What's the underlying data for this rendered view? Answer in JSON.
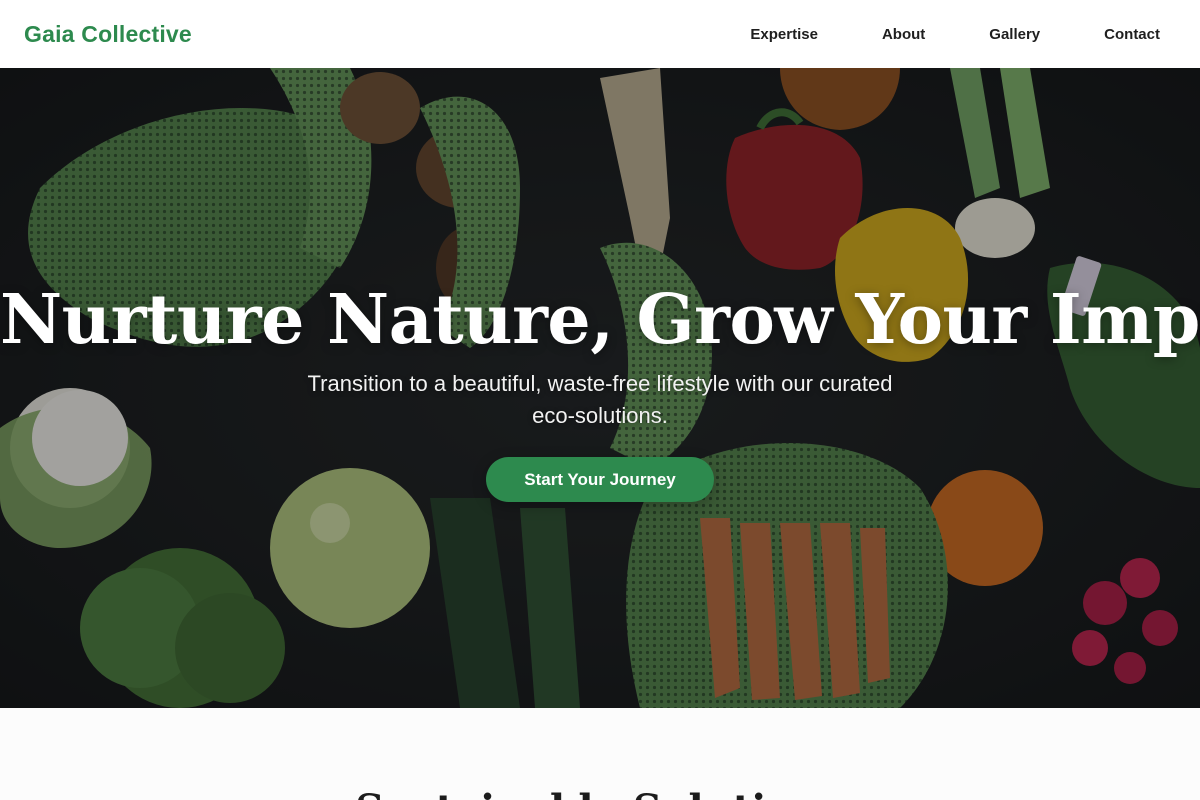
{
  "brand": {
    "name": "Gaia Collective",
    "color": "#2d8a4e"
  },
  "nav": {
    "links": [
      {
        "label": "Expertise"
      },
      {
        "label": "About"
      },
      {
        "label": "Gallery"
      },
      {
        "label": "Contact"
      }
    ]
  },
  "hero": {
    "title": "Nurture Nature, Grow Your Impact.",
    "subtitle": "Transition to a beautiful, waste-free lifestyle with our curated eco-solutions.",
    "cta_label": "Start Your Journey",
    "background_image": "dark-vegetables-in-green-mesh-bags",
    "accent_color": "#2d8a4e"
  },
  "section": {
    "title": "Sustainable Solutions"
  }
}
